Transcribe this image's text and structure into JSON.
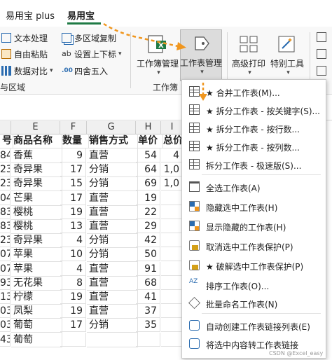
{
  "tabs": [
    {
      "label": "易用宝 plus"
    },
    {
      "label": "易用宝"
    }
  ],
  "ribbon": {
    "small_buttons": {
      "text_process": "文本处理",
      "auto_paste": "自由粘贴",
      "data_compare": "数据对比",
      "multi_area_copy": "多区域复制",
      "superscript": "设置上下标",
      "round": "四舍五入"
    },
    "big_buttons": {
      "workbook_mgmt": "工作簿管理",
      "worksheet_mgmt": "工作表管理",
      "advanced_print": "高级打印",
      "special_tools": "特别工具"
    },
    "groups": {
      "group1_partial": "与区域",
      "group2_partial": "工作簿"
    },
    "icons": {
      "text_process": "text-process-icon",
      "auto_paste": "paste-icon",
      "data_compare": "compare-icon",
      "multi_area_copy": "copy-icon",
      "superscript": "superscript-icon",
      "round": "round-icon"
    }
  },
  "sheet": {
    "columns": [
      {
        "letter": "E"
      },
      {
        "letter": "F"
      },
      {
        "letter": "G"
      },
      {
        "letter": "H"
      },
      {
        "letter": "I"
      }
    ],
    "header_row": [
      "号",
      "商品名称",
      "数量",
      "销售方式",
      "单价",
      "总价"
    ],
    "rows": [
      [
        "84",
        "香蕉",
        "9",
        "直营",
        "54",
        "4"
      ],
      [
        "23",
        "奇异果",
        "17",
        "分销",
        "64",
        "1,0"
      ],
      [
        "23",
        "奇异果",
        "15",
        "分销",
        "69",
        "1,0"
      ],
      [
        "04",
        "芒果",
        "17",
        "直营",
        "19",
        ""
      ],
      [
        "83",
        "樱桃",
        "19",
        "直营",
        "22",
        ""
      ],
      [
        "83",
        "樱桃",
        "13",
        "直营",
        "29",
        ""
      ],
      [
        "23",
        "奇异果",
        "4",
        "分销",
        "42",
        ""
      ],
      [
        "07",
        "苹果",
        "10",
        "分销",
        "50",
        ""
      ],
      [
        "07",
        "苹果",
        "4",
        "直营",
        "91",
        ""
      ],
      [
        "93",
        "无花果",
        "8",
        "直营",
        "68",
        ""
      ],
      [
        "13",
        "柠檬",
        "19",
        "直营",
        "41",
        ""
      ],
      [
        "03",
        "凤梨",
        "19",
        "直营",
        "37",
        ""
      ],
      [
        "03",
        "葡萄",
        "17",
        "分销",
        "35",
        ""
      ],
      [
        "43",
        "葡萄",
        "",
        "",
        "",
        ""
      ]
    ]
  },
  "menu": {
    "items": [
      {
        "label": "★ 合并工作表(M)..."
      },
      {
        "label": "★ 拆分工作表 - 按关键字(S)..."
      },
      {
        "label": "★ 拆分工作表 - 按行数..."
      },
      {
        "label": "★ 拆分工作表 - 按列数..."
      },
      {
        "label": "拆分工作表 - 极速版(S)..."
      },
      {
        "label": "全选工作表(A)"
      },
      {
        "label": "隐藏选中工作表(H)"
      },
      {
        "label": "显示隐藏的工作表(H)"
      },
      {
        "label": "取消选中工作表保护(P)"
      },
      {
        "label": "★ 破解选中工作表保护(P)"
      },
      {
        "label": "排序工作表(O)..."
      },
      {
        "label": "批量命名工作表(N)"
      },
      {
        "label": "自动创建工作表链接列表(E)"
      },
      {
        "label": "将选中内容转工作表链接"
      }
    ]
  },
  "watermark": "CSDN @Excel_easy",
  "colors": {
    "accent": "#1f7a45",
    "annotation": "#f0961e",
    "highlight": "#d9d9d9"
  }
}
